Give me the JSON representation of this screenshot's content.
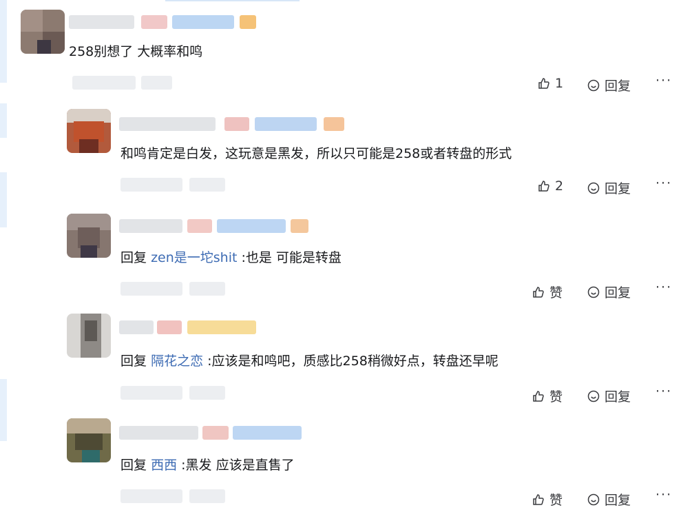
{
  "comments": [
    {
      "text": "258别想了 大概率和鸣",
      "mention": "",
      "like_label": "1",
      "reply_label": "回复",
      "more_label": "···"
    },
    {
      "text": "和鸣肯定是白发，这玩意是黑发，所以只可能是258或者转盘的形式",
      "mention": "",
      "like_label": "2",
      "reply_label": "回复",
      "more_label": "···"
    },
    {
      "reply_prefix": "回复",
      "mention": "zen是一坨shit",
      "text": ":也是 可能是转盘",
      "like_label": "赞",
      "reply_label": "回复",
      "more_label": "···"
    },
    {
      "reply_prefix": "回复",
      "mention": "隔花之恋",
      "text": ":应该是和鸣吧，质感比258稍微好点，转盘还早呢",
      "like_label": "赞",
      "reply_label": "回复",
      "more_label": "···"
    },
    {
      "reply_prefix": "回复",
      "mention": "西西",
      "text": ":黑发 应该是直售了",
      "like_label": "赞",
      "reply_label": "回复",
      "more_label": "···"
    }
  ],
  "icons": {
    "like": "thumbs-up-icon",
    "reply": "speech-bubble-icon",
    "more": "ellipsis-icon"
  },
  "colors": {
    "mention": "#3d6bb3",
    "text": "#18191c",
    "meta_blur": "#e9ebee",
    "accent_blue": "#9ec3f0"
  }
}
